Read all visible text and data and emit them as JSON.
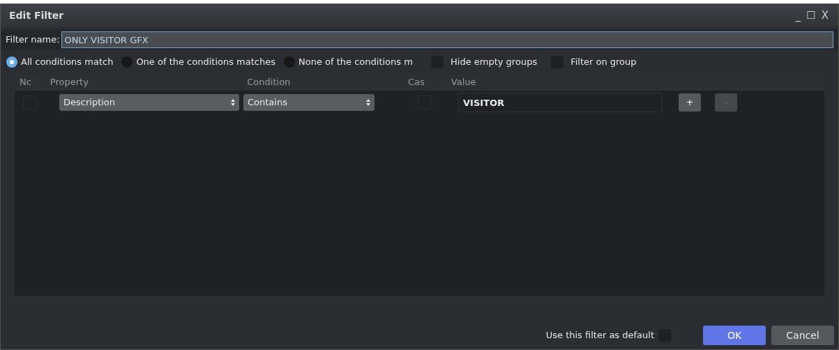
{
  "window": {
    "title": "Edit Filter",
    "controls": [
      "_",
      "☐",
      "X"
    ]
  },
  "filter_name": {
    "label": "Filter name:",
    "value": "ONLY VISITOR GFX"
  },
  "match_modes": [
    {
      "label": "All conditions match",
      "selected": true
    },
    {
      "label": "One of the conditions matches",
      "selected": false
    },
    {
      "label": "None of the conditions m",
      "selected": false
    }
  ],
  "options": [
    {
      "label": "Hide empty groups",
      "checked": false
    },
    {
      "label": "Filter on group",
      "checked": false
    }
  ],
  "table": {
    "columns": [
      "Nc",
      "Property",
      "Condition",
      "Cas",
      "Value"
    ],
    "rows": [
      {
        "negate": false,
        "property": "Description",
        "condition": "Contains",
        "case": false,
        "value": "VISITOR",
        "add": "+",
        "remove": "-"
      }
    ]
  },
  "default_option": {
    "label": "Use this filter as default",
    "checked": false
  },
  "buttons": [
    {
      "label": "OK",
      "kind": "primary"
    },
    {
      "label": "Cancel",
      "kind": "secondary"
    }
  ]
}
